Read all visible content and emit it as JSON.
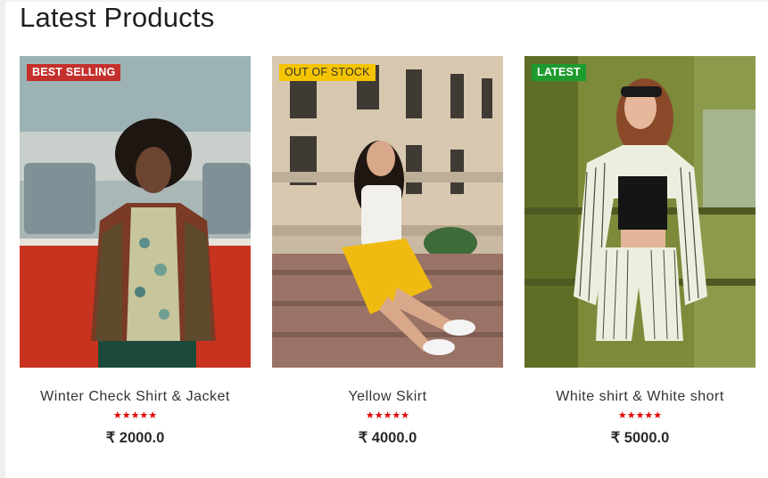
{
  "section": {
    "title": "Latest Products"
  },
  "theme": {
    "star_color": "#e00000"
  },
  "products": [
    {
      "name": "Winter Check Shirt & Jacket",
      "badge": "BEST SELLING",
      "badge_color": "#c4302b",
      "rating": 5,
      "stars": "★★★★★",
      "price": "₹ 2000.0"
    },
    {
      "name": "Yellow Skirt",
      "badge": "OUT OF STOCK",
      "badge_color": "#f5c400",
      "rating": 5,
      "stars": "★★★★★",
      "price": "₹ 4000.0"
    },
    {
      "name": "White shirt & White short",
      "badge": "LATEST",
      "badge_color": "#1e9b2e",
      "rating": 5,
      "stars": "★★★★★",
      "price": "₹ 5000.0"
    }
  ]
}
